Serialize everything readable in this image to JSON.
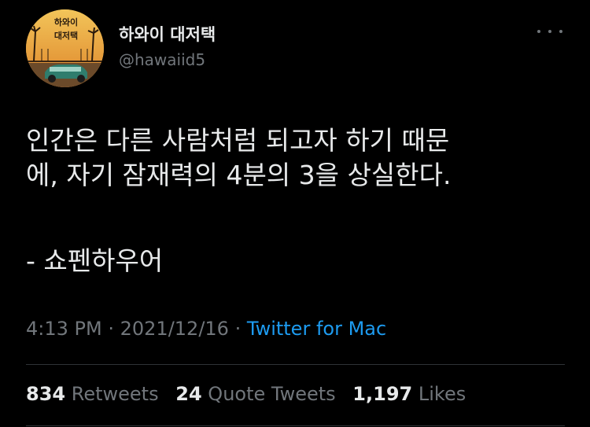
{
  "author": {
    "display_name": "하와이 대저택",
    "handle": "@hawaiid5",
    "avatar": {
      "line1": "하와이",
      "line2": "대저택"
    }
  },
  "tweet": {
    "lines": [
      "인간은 다른 사람처럼 되고자 하기 때문",
      "에, 자기 잠재력의 4분의 3을 상실한다."
    ],
    "attribution": "- 쇼펜하우어"
  },
  "meta": {
    "time": "4:13 PM",
    "separator": "·",
    "date": "2021/12/16",
    "source": "Twitter for Mac"
  },
  "stats": {
    "retweets_count": "834",
    "retweets_label": "Retweets",
    "quotes_count": "24",
    "quotes_label": "Quote Tweets",
    "likes_count": "1,197",
    "likes_label": "Likes"
  },
  "colors": {
    "background": "#000000",
    "text": "#e7e9ea",
    "muted": "#71767b",
    "link": "#1d9bf0"
  },
  "icons": [
    "more-icon"
  ]
}
